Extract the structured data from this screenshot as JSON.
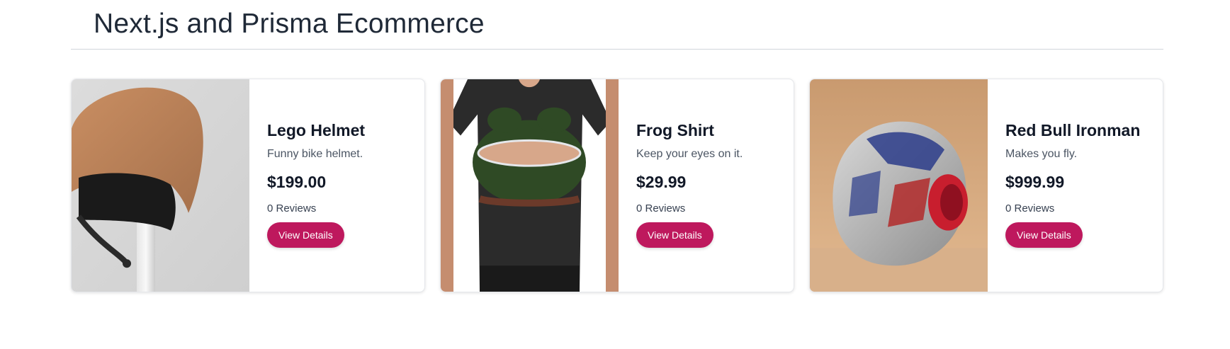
{
  "header": {
    "title": "Next.js and Prisma Ecommerce"
  },
  "products": [
    {
      "name": "Lego Helmet",
      "description": "Funny bike helmet.",
      "price": "$199.00",
      "reviews": "0 Reviews",
      "button_label": "View Details",
      "image": "lego-helmet-image"
    },
    {
      "name": "Frog Shirt",
      "description": "Keep your eyes on it.",
      "price": "$29.99",
      "reviews": "0 Reviews",
      "button_label": "View Details",
      "image": "frog-shirt-image"
    },
    {
      "name": "Red Bull Ironman",
      "description": "Makes you fly.",
      "price": "$999.99",
      "reviews": "0 Reviews",
      "button_label": "View Details",
      "image": "ironman-helmet-image"
    }
  ],
  "colors": {
    "accent": "#be185d",
    "title": "#1f2937",
    "divider": "#d1d5db"
  }
}
